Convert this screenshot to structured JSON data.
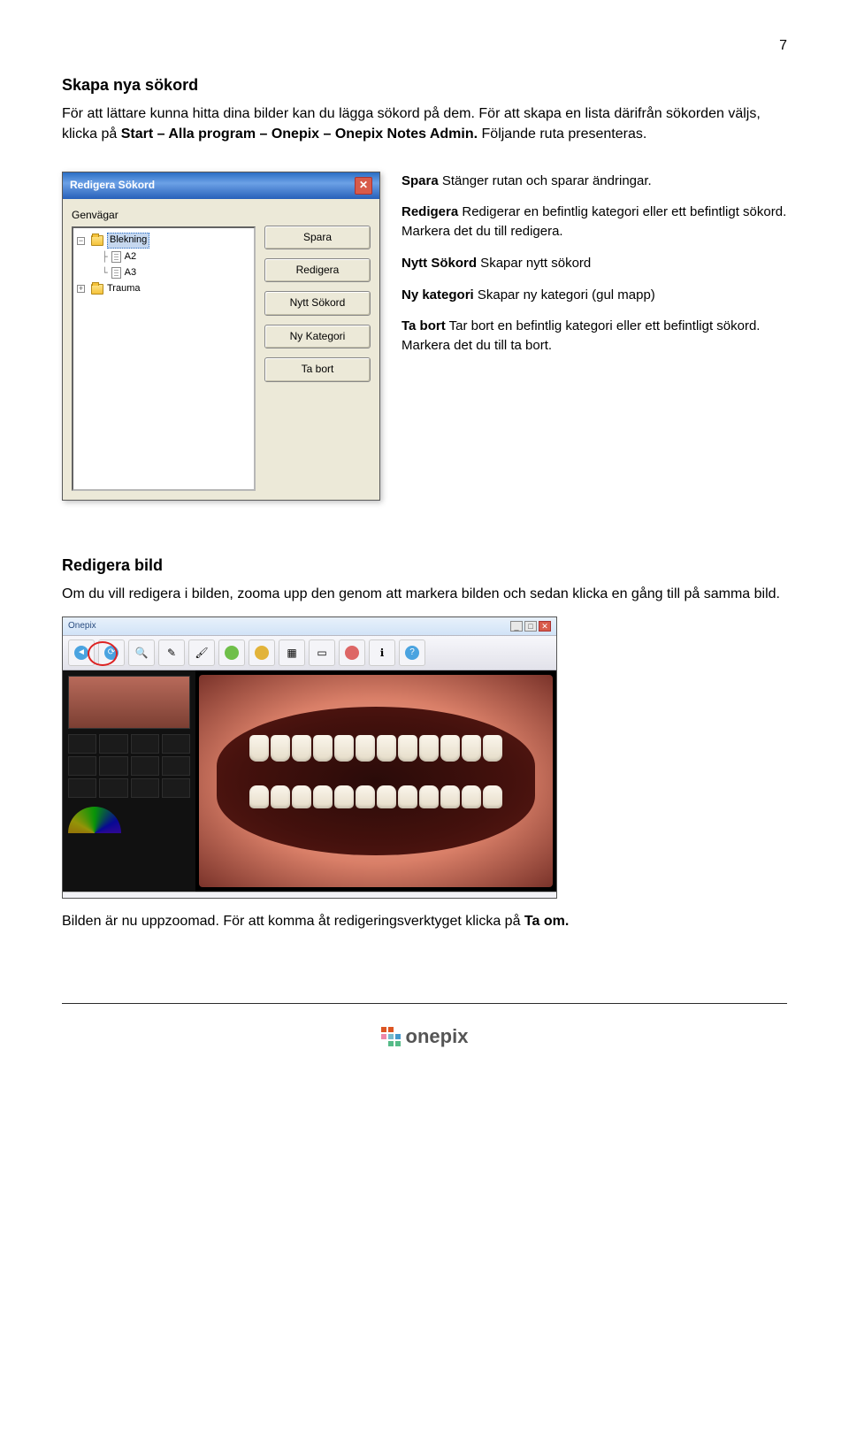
{
  "page_number": "7",
  "section1": {
    "heading": "Skapa nya sökord",
    "para1_pre": "För att lättare kunna hitta dina bilder kan du lägga sökord på dem. För att skapa en lista därifrån sökorden väljs, klicka på ",
    "para1_bold": "Start – Alla program – Onepix – Onepix Notes Admin.",
    "para1_post": " Följande ruta presenteras."
  },
  "dialog": {
    "title": "Redigera Sökord",
    "tree_label": "Genvägar",
    "items": {
      "blekning": "Blekning",
      "a2": "A2",
      "a3": "A3",
      "trauma": "Trauma"
    },
    "buttons": {
      "spara": "Spara",
      "redigera": "Redigera",
      "nytt": "Nytt Sökord",
      "nykat": "Ny Kategori",
      "tabort": "Ta bort"
    }
  },
  "desc": {
    "spara_b": "Spara",
    "spara_t": " Stänger rutan och sparar ändringar.",
    "redigera_b": "Redigera",
    "redigera_t": " Redigerar en befintlig kategori eller ett befintligt sökord. Markera det du till redigera.",
    "nytt_b": "Nytt Sökord",
    "nytt_t": " Skapar nytt sökord",
    "nykat_b": "Ny kategori",
    "nykat_t": " Skapar ny kategori (gul mapp)",
    "tabort_b": "Ta bort",
    "tabort_t": " Tar bort en befintlig kategori eller ett befintligt sökord. Markera det du till ta bort."
  },
  "section2": {
    "heading": "Redigera bild",
    "para": "Om du vill redigera i bilden, zooma upp den genom att markera bilden och sedan klicka en gång till på samma bild."
  },
  "app": {
    "title": "Onepix",
    "status_left": "",
    "status_center": "",
    "status_right": ""
  },
  "closing": {
    "line1": "Bilden är nu uppzoomad. För att komma åt redigeringsverktyget klicka på ",
    "bold": "Ta om."
  },
  "footer": {
    "brand": "onepix"
  }
}
